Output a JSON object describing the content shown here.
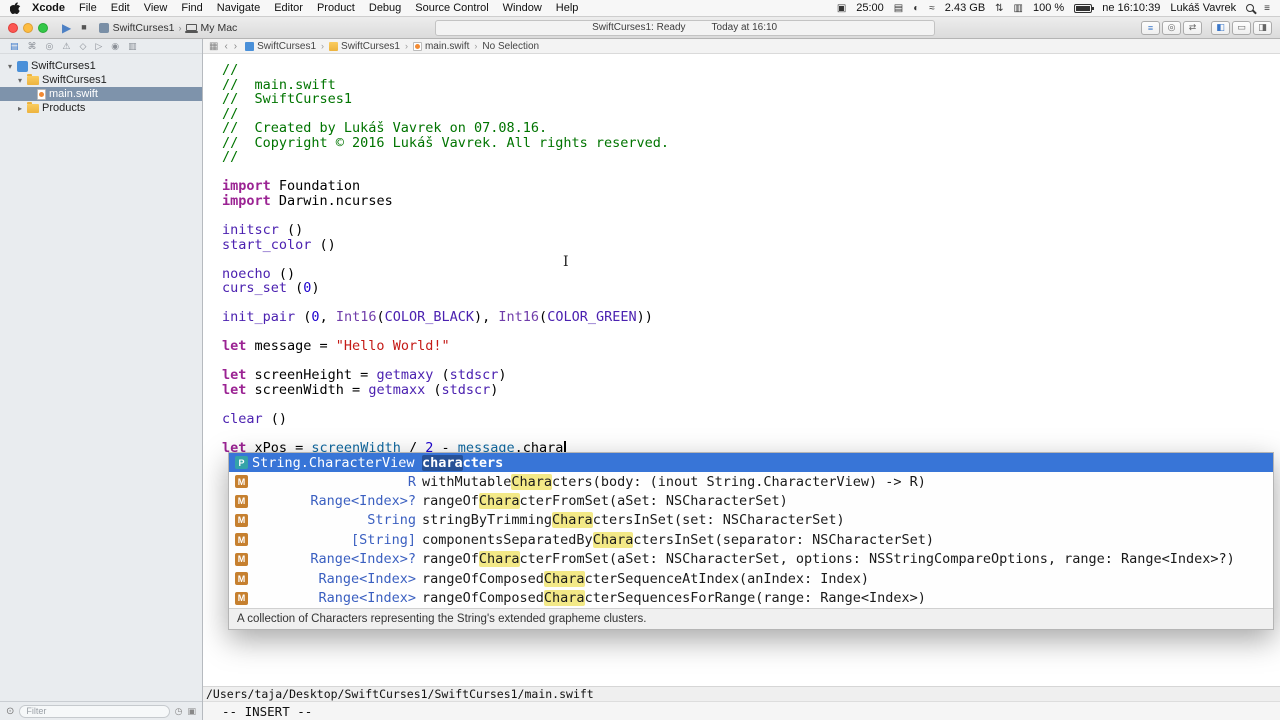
{
  "menu_bar": {
    "items": [
      "Xcode",
      "File",
      "Edit",
      "View",
      "Find",
      "Navigate",
      "Editor",
      "Product",
      "Debug",
      "Source Control",
      "Window",
      "Help"
    ],
    "status": [
      {
        "name": "menubar-extra-icon",
        "glyph": "▣"
      },
      {
        "name": "timer",
        "text": "25:00"
      },
      {
        "name": "display-icon",
        "glyph": "▤"
      },
      {
        "name": "volume-icon",
        "glyph": "◐"
      },
      {
        "name": "airplay-icon",
        "glyph": "≈"
      },
      {
        "name": "memory",
        "text": "2.43 GB"
      },
      {
        "name": "updown-icon",
        "glyph": "⇅"
      },
      {
        "name": "keyboard-icon",
        "glyph": "▥"
      },
      {
        "name": "battery-percent",
        "text": "100 %"
      },
      {
        "name": "battery-icon",
        "type": "battery"
      },
      {
        "name": "clock",
        "text": "ne 16:10:39"
      },
      {
        "name": "user-name",
        "text": "Lukáš Vavrek"
      },
      {
        "name": "spotlight-icon",
        "type": "mag"
      },
      {
        "name": "notification-center-icon",
        "glyph": "≡"
      }
    ]
  },
  "toolbar": {
    "run_glyph": "▶",
    "stop_glyph": "■",
    "scheme": "SwiftCurses1",
    "device": "My Mac",
    "status_main": "SwiftCurses1: Ready",
    "status_time": "Today at 16:10",
    "editor_buttons": [
      {
        "name": "standard-editor-button",
        "glyph": "≡",
        "active": true
      },
      {
        "name": "assistant-editor-button",
        "glyph": "◎",
        "active": false
      },
      {
        "name": "version-editor-button",
        "glyph": "⇄",
        "active": false
      }
    ],
    "view_buttons": [
      {
        "name": "navigator-toggle-button",
        "glyph": "◧",
        "active": true
      },
      {
        "name": "debug-area-toggle-button",
        "glyph": "▭",
        "active": false
      },
      {
        "name": "utilities-toggle-button",
        "glyph": "◨",
        "active": false
      }
    ]
  },
  "breadcrumb": [
    {
      "icon": "project",
      "label": "SwiftCurses1"
    },
    {
      "icon": "folder",
      "label": "SwiftCurses1"
    },
    {
      "icon": "swift",
      "label": "main.swift"
    },
    {
      "icon": null,
      "label": "No Selection"
    }
  ],
  "sidebar": {
    "nav_icons": [
      {
        "name": "project-navigator-icon",
        "glyph": "▤",
        "active": true
      },
      {
        "name": "symbol-navigator-icon",
        "glyph": "⌘",
        "active": false
      },
      {
        "name": "search-navigator-icon",
        "glyph": "◎",
        "active": false
      },
      {
        "name": "issue-navigator-icon",
        "glyph": "⚠",
        "active": false
      },
      {
        "name": "test-navigator-icon",
        "glyph": "◇",
        "active": false
      },
      {
        "name": "debug-navigator-icon",
        "glyph": "▷",
        "active": false
      },
      {
        "name": "breakpoint-navigator-icon",
        "glyph": "◉",
        "active": false
      },
      {
        "name": "report-navigator-icon",
        "glyph": "▥",
        "active": false
      }
    ],
    "items": [
      {
        "label": "SwiftCurses1",
        "type": "project",
        "depth": 0,
        "disclosure": "open",
        "selected": false
      },
      {
        "label": "SwiftCurses1",
        "type": "folder",
        "depth": 1,
        "disclosure": "open",
        "selected": false
      },
      {
        "label": "main.swift",
        "type": "file",
        "depth": 2,
        "disclosure": "none",
        "selected": true
      },
      {
        "label": "Products",
        "type": "folder",
        "depth": 1,
        "disclosure": "closed",
        "selected": false
      }
    ],
    "filter_placeholder": "Filter"
  },
  "editor": {
    "lines": [
      [
        [
          "c",
          "//"
        ]
      ],
      [
        [
          "c",
          "//  main.swift"
        ]
      ],
      [
        [
          "c",
          "//  SwiftCurses1"
        ]
      ],
      [
        [
          "c",
          "//"
        ]
      ],
      [
        [
          "c",
          "//  Created by Lukáš Vavrek on 07.08.16."
        ]
      ],
      [
        [
          "c",
          "//  Copyright © 2016 Lukáš Vavrek. All rights reserved."
        ]
      ],
      [
        [
          "c",
          "//"
        ]
      ],
      [],
      [
        [
          "k",
          "import"
        ],
        [
          "p",
          " Foundation"
        ]
      ],
      [
        [
          "k",
          "import"
        ],
        [
          "p",
          " Darwin.ncurses"
        ]
      ],
      [],
      [
        [
          "f",
          "initscr"
        ],
        [
          "p",
          " ()"
        ]
      ],
      [
        [
          "f",
          "start_color"
        ],
        [
          "p",
          " ()"
        ]
      ],
      [],
      [
        [
          "f",
          "noecho"
        ],
        [
          "p",
          " ()"
        ]
      ],
      [
        [
          "f",
          "curs_set"
        ],
        [
          "p",
          " ("
        ],
        [
          "n",
          "0"
        ],
        [
          "p",
          ")"
        ]
      ],
      [],
      [
        [
          "f",
          "init_pair"
        ],
        [
          "p",
          " ("
        ],
        [
          "n",
          "0"
        ],
        [
          "p",
          ", "
        ],
        [
          "t",
          "Int16"
        ],
        [
          "p",
          "("
        ],
        [
          "f",
          "COLOR_BLACK"
        ],
        [
          "p",
          "), "
        ],
        [
          "t",
          "Int16"
        ],
        [
          "p",
          "("
        ],
        [
          "f",
          "COLOR_GREEN"
        ],
        [
          "p",
          "))"
        ]
      ],
      [],
      [
        [
          "k",
          "let"
        ],
        [
          "p",
          " message = "
        ],
        [
          "s",
          "\"Hello World!\""
        ]
      ],
      [],
      [
        [
          "k",
          "let"
        ],
        [
          "p",
          " screenHeight = "
        ],
        [
          "f",
          "getmaxy"
        ],
        [
          "p",
          " ("
        ],
        [
          "f",
          "stdscr"
        ],
        [
          "p",
          ")"
        ]
      ],
      [
        [
          "k",
          "let"
        ],
        [
          "p",
          " screenWidth = "
        ],
        [
          "f",
          "getmaxx"
        ],
        [
          "p",
          " ("
        ],
        [
          "f",
          "stdscr"
        ],
        [
          "p",
          ")"
        ]
      ],
      [],
      [
        [
          "f",
          "clear"
        ],
        [
          "p",
          " ()"
        ]
      ],
      [],
      [
        [
          "k",
          "let"
        ],
        [
          "p",
          " xPos = "
        ],
        [
          "v",
          "screenWidth"
        ],
        [
          "p",
          " / "
        ],
        [
          "n",
          "2"
        ],
        [
          "p",
          " - "
        ],
        [
          "v",
          "message"
        ],
        [
          "p",
          ".chara"
        ],
        [
          "caret",
          ""
        ]
      ]
    ]
  },
  "autocomplete": {
    "selected": {
      "icon": "P",
      "type": "String.CharacterView",
      "match": "chara",
      "rest": "cters"
    },
    "rows": [
      {
        "icon": "M",
        "ret": "R",
        "pre": "withMutable",
        "match": "Chara",
        "post": "cters(body: (inout String.CharacterView) -> R)"
      },
      {
        "icon": "M",
        "ret": "Range<Index>?",
        "pre": "rangeOf",
        "match": "Chara",
        "post": "cterFromSet(aSet: NSCharacterSet)"
      },
      {
        "icon": "M",
        "ret": "String",
        "pre": "stringByTrimming",
        "match": "Chara",
        "post": "ctersInSet(set: NSCharacterSet)"
      },
      {
        "icon": "M",
        "ret": "[String]",
        "pre": "componentsSeparatedBy",
        "match": "Chara",
        "post": "ctersInSet(separator: NSCharacterSet)"
      },
      {
        "icon": "M",
        "ret": "Range<Index>?",
        "pre": "rangeOf",
        "match": "Chara",
        "post": "cterFromSet(aSet: NSCharacterSet, options: NSStringCompareOptions, range: Range<Index>?)"
      },
      {
        "icon": "M",
        "ret": "Range<Index>",
        "pre": "rangeOfComposed",
        "match": "Chara",
        "post": "cterSequenceAtIndex(anIndex: Index)"
      },
      {
        "icon": "M",
        "ret": "Range<Index>",
        "pre": "rangeOfComposed",
        "match": "Chara",
        "post": "cterSequencesForRange(range: Range<Index>)"
      }
    ],
    "footer": "A collection of Characters representing the String's extended grapheme clusters."
  },
  "statusbar": {
    "path": "/Users/taja/Desktop/SwiftCurses1/SwiftCurses1/main.swift",
    "mode": "-- INSERT --"
  }
}
